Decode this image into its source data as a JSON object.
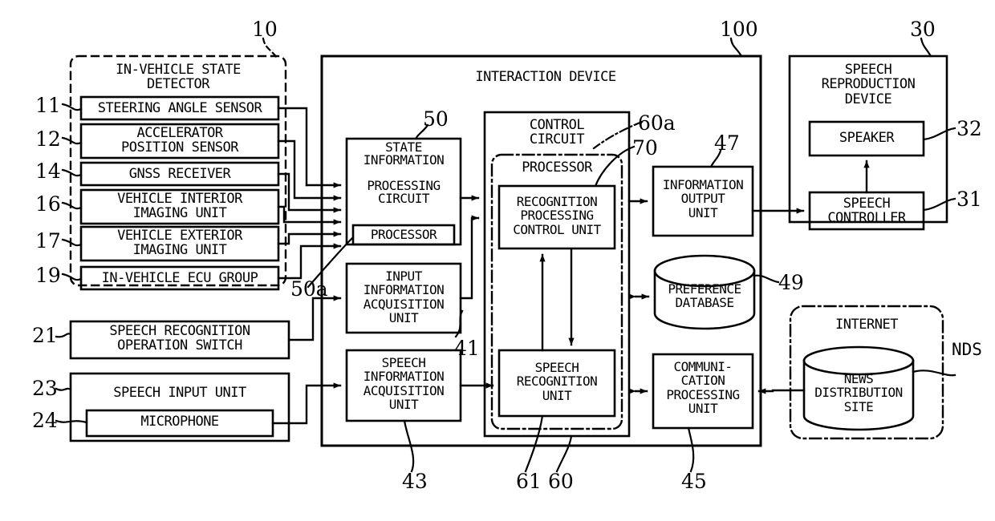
{
  "figure": {
    "type": "patent-block-diagram",
    "title": "Interaction Device System Block Diagram"
  },
  "groups": {
    "in_vehicle_state_detector": {
      "title": "IN-VEHICLE STATE\nDETECTOR",
      "ref": "10",
      "border": "dashed",
      "items": [
        {
          "ref": "11",
          "label": "STEERING ANGLE SENSOR"
        },
        {
          "ref": "12",
          "label": "ACCELERATOR\nPOSITION SENSOR"
        },
        {
          "ref": "14",
          "label": "GNSS RECEIVER"
        },
        {
          "ref": "16",
          "label": "VEHICLE INTERIOR\nIMAGING UNIT"
        },
        {
          "ref": "17",
          "label": "VEHICLE EXTERIOR\nIMAGING UNIT"
        },
        {
          "ref": "19",
          "label": "IN-VEHICLE ECU GROUP"
        }
      ]
    },
    "interaction_device": {
      "title": "INTERACTION DEVICE",
      "ref": "100",
      "border": "solid"
    },
    "control_circuit": {
      "title": "CONTROL\nCIRCUIT",
      "ref": "60",
      "border": "solid"
    },
    "processor_inner": {
      "title": "PROCESSOR",
      "ref": "60a",
      "border": "dash-dot"
    },
    "speech_reproduction_device": {
      "title": "SPEECH\nREPRODUCTION\nDEVICE",
      "ref": "30",
      "border": "solid"
    },
    "internet": {
      "title": "INTERNET",
      "ref": "",
      "border": "dash-dot"
    }
  },
  "blocks": {
    "speech_recognition_operation_switch": {
      "label": "SPEECH RECOGNITION\nOPERATION SWITCH",
      "ref": "21"
    },
    "speech_input_unit": {
      "label": "SPEECH INPUT UNIT",
      "ref": "23"
    },
    "microphone": {
      "label": "MICROPHONE",
      "ref": "24"
    },
    "state_information_processing_circuit": {
      "label": "STATE\nINFORMATION\n\nPROCESSING\nCIRCUIT",
      "ref": "50"
    },
    "state_processor": {
      "label": "PROCESSOR",
      "ref": "50a"
    },
    "input_information_acquisition_unit": {
      "label": "INPUT\nINFORMATION\nACQUISITION\nUNIT",
      "ref": "41"
    },
    "speech_information_acquisition_unit": {
      "label": "SPEECH\nINFORMATION\nACQUISITION\nUNIT",
      "ref": "43"
    },
    "recognition_processing_control_unit": {
      "label": "RECOGNITION\nPROCESSING\nCONTROL UNIT",
      "ref": "70"
    },
    "speech_recognition_unit": {
      "label": "SPEECH\nRECOGNITION\nUNIT",
      "ref": "61"
    },
    "information_output_unit": {
      "label": "INFORMATION\nOUTPUT\nUNIT",
      "ref": "47"
    },
    "preference_database": {
      "label": "PREFERENCE\nDATABASE",
      "ref": "49"
    },
    "communication_processing_unit": {
      "label": "COMMUNI-\nCATION\nPROCESSING\nUNIT",
      "ref": "45"
    },
    "news_distribution_site": {
      "label": "NEWS\nDISTRIBUTION\nSITE",
      "ref": "NDS"
    },
    "speaker": {
      "label": "SPEAKER",
      "ref": "32"
    },
    "speech_controller": {
      "label": "SPEECH\nCONTROLLER",
      "ref": "31"
    }
  },
  "reference_numbers": [
    "10",
    "11",
    "12",
    "14",
    "16",
    "17",
    "19",
    "21",
    "23",
    "24",
    "50",
    "50a",
    "41",
    "43",
    "100",
    "60",
    "60a",
    "61",
    "70",
    "47",
    "49",
    "45",
    "30",
    "31",
    "32",
    "NDS"
  ],
  "colors": {
    "stroke": "#000000",
    "background": "#ffffff"
  }
}
